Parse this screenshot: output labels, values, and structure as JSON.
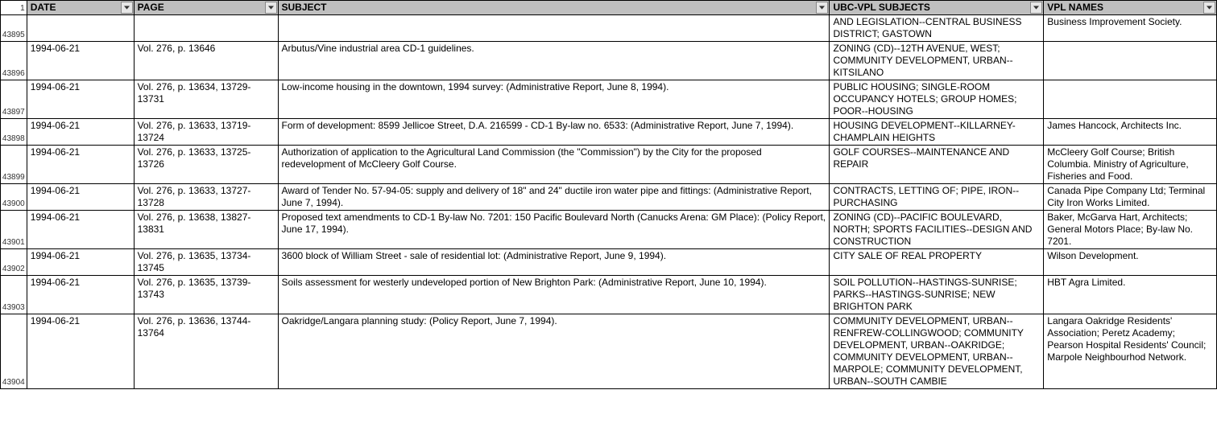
{
  "header": {
    "rownum": "1",
    "cols": [
      "DATE",
      "PAGE",
      "SUBJECT",
      "UBC-VPL SUBJECTS",
      "VPL NAMES"
    ]
  },
  "rows": [
    {
      "rownum": "43895",
      "date": "",
      "page": "",
      "subject": "",
      "ubc": "AND LEGISLATION--CENTRAL BUSINESS DISTRICT; GASTOWN",
      "vpl": "Business Improvement Society."
    },
    {
      "rownum": "43896",
      "date": "1994-06-21",
      "page": "Vol. 276, p. 13646",
      "subject": "Arbutus/Vine industrial area CD-1 guidelines.",
      "ubc": "ZONING (CD)--12TH AVENUE, WEST; COMMUNITY DEVELOPMENT, URBAN--KITSILANO",
      "vpl": ""
    },
    {
      "rownum": "43897",
      "date": "1994-06-21",
      "page": "Vol. 276, p. 13634, 13729-13731",
      "subject": "Low-income housing in the downtown, 1994 survey: (Administrative Report, June 8, 1994).",
      "ubc": "PUBLIC HOUSING; SINGLE-ROOM OCCUPANCY HOTELS; GROUP HOMES; POOR--HOUSING",
      "vpl": ""
    },
    {
      "rownum": "43898",
      "date": "1994-06-21",
      "page": "Vol. 276, p. 13633, 13719-13724",
      "subject": "Form of development: 8599 Jellicoe Street, D.A. 216599 - CD-1 By-law no. 6533: (Administrative Report, June 7, 1994).",
      "ubc": "HOUSING DEVELOPMENT--KILLARNEY-CHAMPLAIN HEIGHTS",
      "vpl": "James Hancock, Architects Inc."
    },
    {
      "rownum": "43899",
      "date": "1994-06-21",
      "page": "Vol. 276, p. 13633, 13725-13726",
      "subject": "Authorization of application to the Agricultural Land Commission (the \"Commission\") by the City for the proposed redevelopment of McCleery Golf Course.",
      "ubc": "GOLF COURSES--MAINTENANCE AND REPAIR",
      "vpl": "McCleery Golf Course; British Columbia. Ministry of Agriculture, Fisheries and Food."
    },
    {
      "rownum": "43900",
      "date": "1994-06-21",
      "page": "Vol. 276, p. 13633, 13727-13728",
      "subject": "Award of Tender No. 57-94-05: supply and delivery of 18\" and 24\" ductile iron water pipe and fittings: (Administrative Report, June 7, 1994).",
      "ubc": "CONTRACTS, LETTING OF; PIPE, IRON--PURCHASING",
      "vpl": "Canada Pipe Company Ltd; Terminal City Iron Works Limited."
    },
    {
      "rownum": "43901",
      "date": "1994-06-21",
      "page": "Vol. 276, p. 13638, 13827-13831",
      "subject": "Proposed text amendments to CD-1 By-law No. 7201: 150 Pacific Boulevard North (Canucks Arena: GM Place): (Policy Report, June 17, 1994).",
      "ubc": "ZONING (CD)--PACIFIC BOULEVARD, NORTH; SPORTS FACILITIES--DESIGN AND CONSTRUCTION",
      "vpl": "Baker, McGarva Hart, Architects; General Motors Place; By-law No. 7201."
    },
    {
      "rownum": "43902",
      "date": "1994-06-21",
      "page": "Vol. 276, p. 13635, 13734-13745",
      "subject": "3600 block of William Street - sale of residential lot: (Administrative Report, June 9, 1994).",
      "ubc": "CITY SALE OF REAL PROPERTY",
      "vpl": "Wilson Development."
    },
    {
      "rownum": "43903",
      "date": "1994-06-21",
      "page": "Vol. 276, p. 13635, 13739-13743",
      "subject": "Soils assessment for westerly undeveloped portion of New Brighton Park: (Administrative Report, June 10, 1994).",
      "ubc": "SOIL POLLUTION--HASTINGS-SUNRISE; PARKS--HASTINGS-SUNRISE; NEW BRIGHTON PARK",
      "vpl": "HBT Agra Limited."
    },
    {
      "rownum": "43904",
      "date": "1994-06-21",
      "page": "Vol. 276, p. 13636, 13744-13764",
      "subject": "Oakridge/Langara planning study: (Policy Report, June 7, 1994).",
      "ubc": "COMMUNITY DEVELOPMENT, URBAN--RENFREW-COLLINGWOOD; COMMUNITY DEVELOPMENT, URBAN--OAKRIDGE; COMMUNITY DEVELOPMENT, URBAN--MARPOLE; COMMUNITY DEVELOPMENT, URBAN--SOUTH CAMBIE",
      "vpl": "Langara Oakridge Residents' Association; Peretz Academy; Pearson Hospital Residents' Council; Marpole Neighbourhod Network."
    }
  ]
}
